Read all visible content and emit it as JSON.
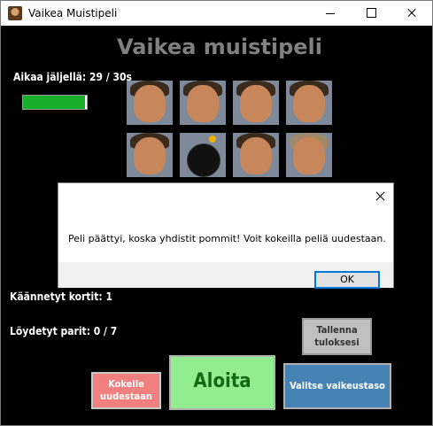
{
  "window": {
    "title": "Vaikea Muistipeli"
  },
  "game": {
    "title": "Vaikea muistipeli",
    "timer_label": "Aikaa jäljellä: 29 / 30s",
    "time_remaining": 29,
    "time_total": 30,
    "progress_fraction": 0.97,
    "progress_color": "#1aaf2a",
    "turned_label": "Käännetyt kortit: 1",
    "found_label": "Löydetyt parit: 0 / 7"
  },
  "cards": [
    {
      "content": "face-photo"
    },
    {
      "content": "face-photo"
    },
    {
      "content": "face-photo"
    },
    {
      "content": "face-photo"
    },
    {
      "content": "face-photo"
    },
    {
      "content": "bomb-icon"
    },
    {
      "content": "face-photo"
    },
    {
      "content": "face-photo"
    }
  ],
  "buttons": {
    "save_line1": "Tallenna",
    "save_line2": "tuloksesi",
    "retry_line1": "Kokeile",
    "retry_line2": "uudestaan",
    "start": "Aloita",
    "difficulty": "Valitse vaikeustaso"
  },
  "dialog": {
    "message": "Peli päättyi, koska yhdistit pommit!  Voit kokeilla peliä uudestaan.",
    "ok": "OK"
  },
  "colors": {
    "background": "#000000",
    "start_button": "#90ee90",
    "retry_button": "#f08080",
    "difficulty_button": "#4682b4",
    "save_button": "#c0c0c0"
  }
}
